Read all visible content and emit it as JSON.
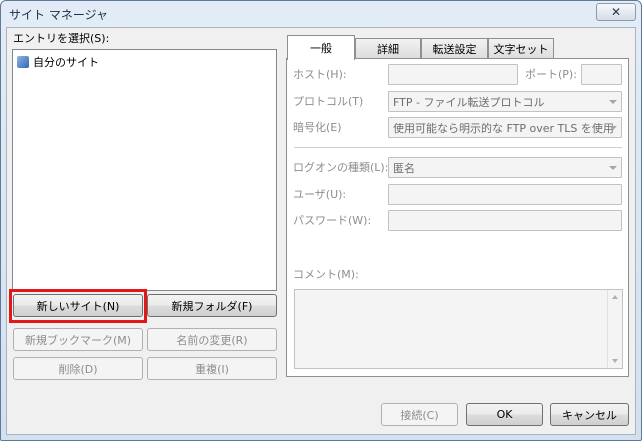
{
  "window": {
    "title": "サイト マネージャ",
    "close_glyph": "✕"
  },
  "left": {
    "entry_label": "エントリを選択(S):",
    "tree_items": [
      {
        "label": "自分のサイト"
      }
    ],
    "buttons": {
      "new_site": "新しいサイト(N)",
      "new_folder": "新規フォルダ(F)",
      "new_bookmark": "新規ブックマーク(M)",
      "rename": "名前の変更(R)",
      "delete": "削除(D)",
      "duplicate": "重複(I)"
    }
  },
  "tabs": [
    {
      "label": "一般",
      "active": true
    },
    {
      "label": "詳細",
      "active": false
    },
    {
      "label": "転送設定",
      "active": false
    },
    {
      "label": "文字セット",
      "active": false
    }
  ],
  "general": {
    "host_label": "ホスト(H):",
    "host_value": "",
    "port_label": "ポート(P):",
    "port_value": "",
    "protocol_label": "プロトコル(T)",
    "protocol_value": "FTP - ファイル転送プロトコル",
    "encryption_label": "暗号化(E)",
    "encryption_value": "使用可能なら明示的な FTP over TLS を使用",
    "logon_type_label": "ログオンの種類(L):",
    "logon_type_value": "匿名",
    "user_label": "ユーザ(U):",
    "user_value": "",
    "password_label": "パスワード(W):",
    "password_value": "",
    "comment_label": "コメント(M):"
  },
  "footer": {
    "connect": "接続(C)",
    "ok": "OK",
    "cancel": "キャンセル"
  }
}
